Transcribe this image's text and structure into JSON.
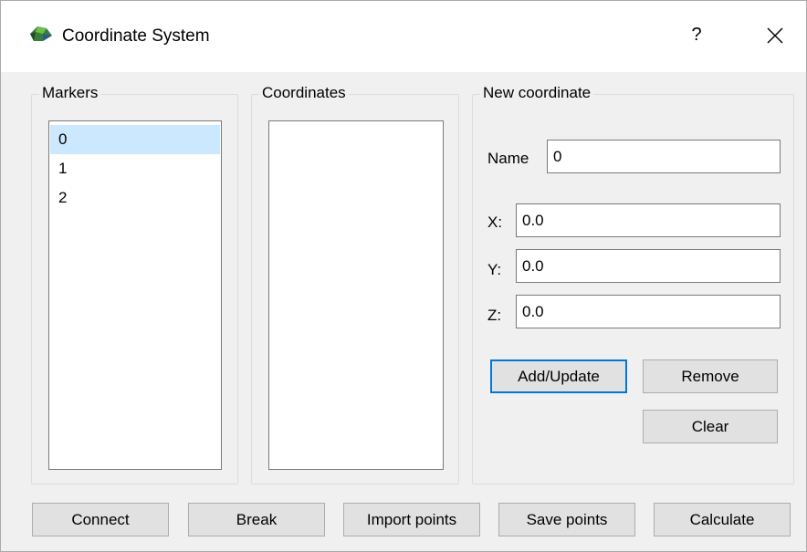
{
  "window": {
    "title": "Coordinate System",
    "help_label": "?",
    "close_label": "✕"
  },
  "markers": {
    "label": "Markers",
    "items": [
      "0",
      "1",
      "2"
    ],
    "selected_index": 0
  },
  "coordinates": {
    "label": "Coordinates",
    "items": []
  },
  "new_coordinate": {
    "label": "New coordinate",
    "name_label": "Name",
    "name_value": "0",
    "x_label": "X:",
    "x_value": "0.0",
    "y_label": "Y:",
    "y_value": "0.0",
    "z_label": "Z:",
    "z_value": "0.0",
    "add_update_label": "Add/Update",
    "remove_label": "Remove",
    "clear_label": "Clear"
  },
  "bottom_buttons": {
    "connect": "Connect",
    "break": "Break",
    "import_points": "Import points",
    "save_points": "Save points",
    "calculate": "Calculate"
  }
}
